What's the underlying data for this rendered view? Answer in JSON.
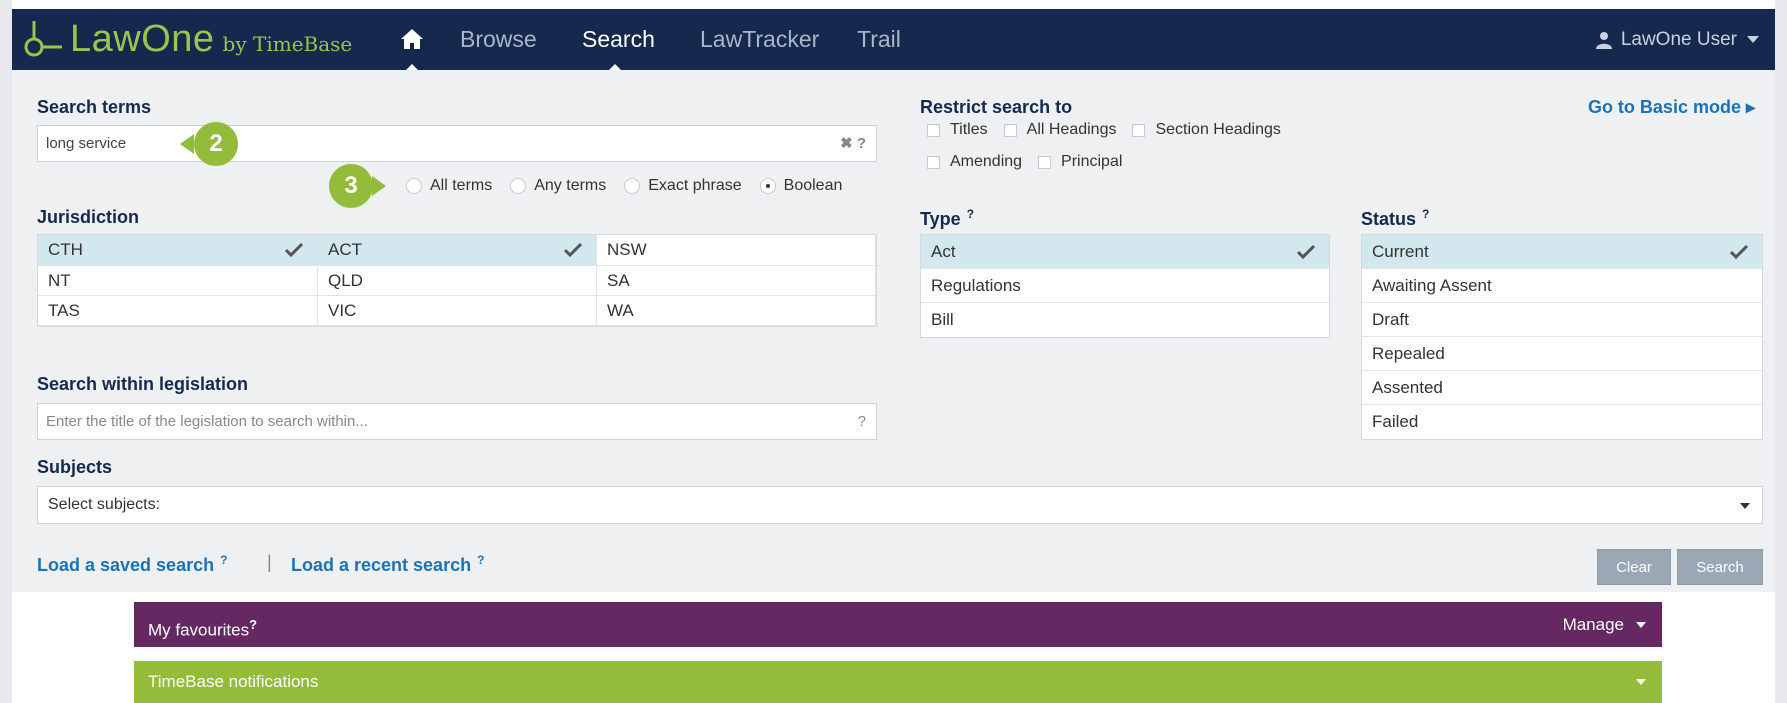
{
  "nav": {
    "brand_name": "LawOne",
    "brand_by": "by TimeBase",
    "items": [
      {
        "label": "Browse",
        "active": false
      },
      {
        "label": "Search",
        "active": true
      },
      {
        "label": "LawTracker",
        "active": false
      },
      {
        "label": "Trail",
        "active": false
      }
    ],
    "user_label": "LawOne User",
    "colors": {
      "background": "#15294f",
      "brand": "#9bc44a"
    }
  },
  "search": {
    "terms_label": "Search terms",
    "terms_value": "long service",
    "terms_suffix": "✖ ?",
    "match_options": [
      {
        "label": "All terms",
        "selected": false
      },
      {
        "label": "Any terms",
        "selected": false
      },
      {
        "label": "Exact phrase",
        "selected": false
      },
      {
        "label": "Boolean",
        "selected": true
      }
    ],
    "callouts": [
      "2",
      "3"
    ],
    "basic_mode_link": "Go to Basic mode ▸"
  },
  "restrict": {
    "label": "Restrict search to",
    "options_row1": [
      "Titles",
      "All Headings",
      "Section Headings"
    ],
    "options_row2": [
      "Amending",
      "Principal"
    ]
  },
  "jurisdiction": {
    "label": "Jurisdiction",
    "cells": [
      {
        "label": "CTH",
        "selected": true
      },
      {
        "label": "ACT",
        "selected": true
      },
      {
        "label": "NSW",
        "selected": false
      },
      {
        "label": "NT",
        "selected": false
      },
      {
        "label": "QLD",
        "selected": false
      },
      {
        "label": "SA",
        "selected": false
      },
      {
        "label": "TAS",
        "selected": false
      },
      {
        "label": "VIC",
        "selected": false
      },
      {
        "label": "WA",
        "selected": false
      }
    ]
  },
  "type": {
    "label": "Type",
    "help": "?",
    "items": [
      {
        "label": "Act",
        "selected": true
      },
      {
        "label": "Regulations",
        "selected": false
      },
      {
        "label": "Bill",
        "selected": false
      }
    ]
  },
  "status": {
    "label": "Status",
    "help": "?",
    "items": [
      {
        "label": "Current",
        "selected": true
      },
      {
        "label": "Awaiting Assent",
        "selected": false
      },
      {
        "label": "Draft",
        "selected": false
      },
      {
        "label": "Repealed",
        "selected": false
      },
      {
        "label": "Assented",
        "selected": false
      },
      {
        "label": "Failed",
        "selected": false
      }
    ]
  },
  "within": {
    "label": "Search within legislation",
    "placeholder": "Enter the title of the legislation to search within...",
    "suffix": "?"
  },
  "subjects": {
    "label": "Subjects",
    "value": "Select subjects:"
  },
  "footer_links": {
    "saved": "Load a saved search",
    "recent": "Load a recent search",
    "help": "?",
    "separator": "|"
  },
  "buttons": {
    "clear": "Clear",
    "search": "Search"
  },
  "panels": {
    "favourites": {
      "label": "My favourites",
      "help": "?",
      "action": "Manage",
      "color": "#652863"
    },
    "notifications": {
      "label": "TimeBase notifications",
      "color": "#93bc3b"
    }
  }
}
